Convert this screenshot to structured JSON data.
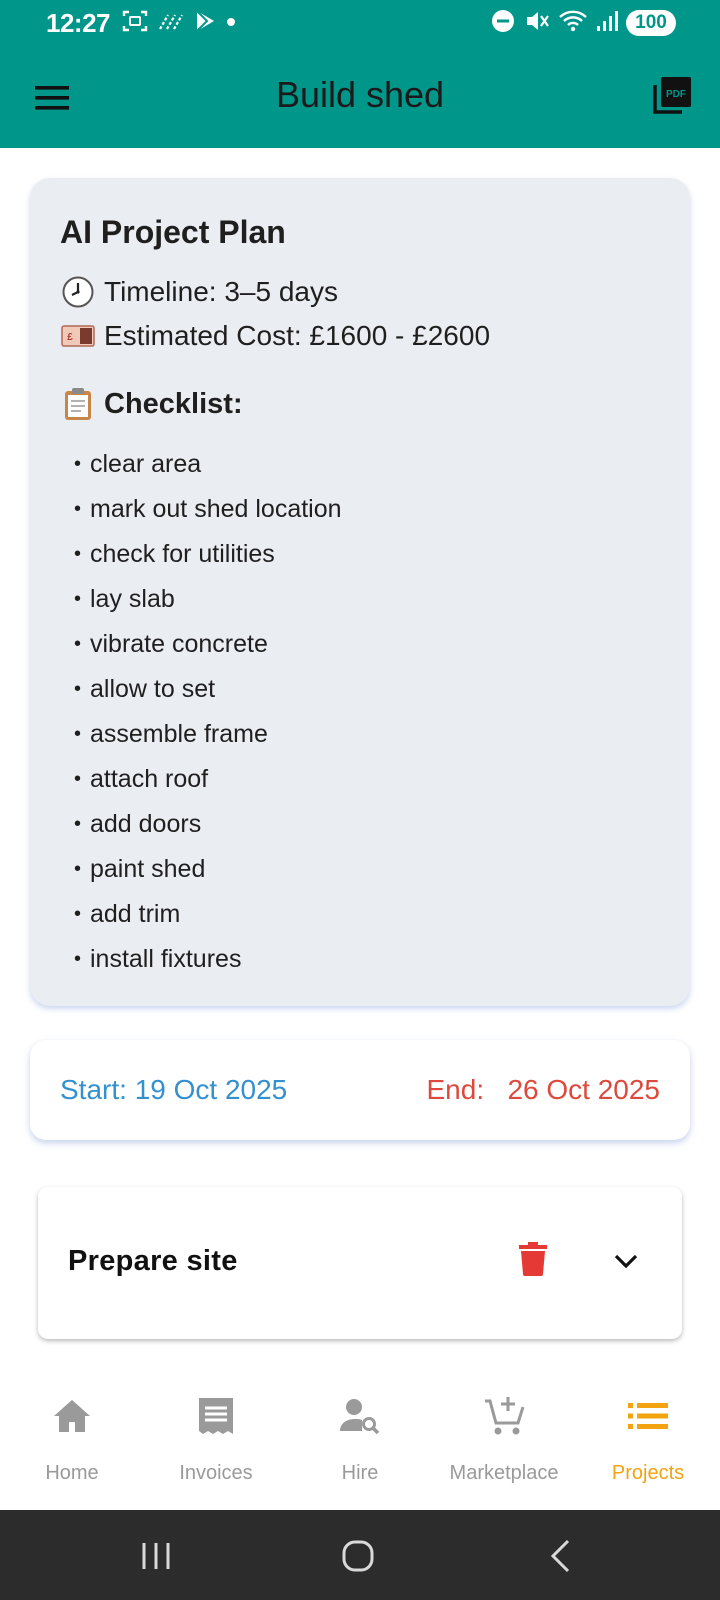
{
  "status_bar": {
    "time": "12:27",
    "battery": "100",
    "icons_left": [
      "screenshot-icon",
      "data-saver-icon",
      "play-store-icon",
      "notification-dot-icon"
    ],
    "icons_right": [
      "dnd-icon",
      "mute-icon",
      "wifi-icon",
      "signal-icon"
    ]
  },
  "app_bar": {
    "title": "Build shed",
    "menu_icon": "menu-icon",
    "pdf_icon": "pdf-icon",
    "background": "#00968a"
  },
  "plan": {
    "title": "AI Project Plan",
    "timeline": "Timeline: 3–5 days",
    "cost": "Estimated Cost: £1600 - £2600",
    "checklist_title": "Checklist:",
    "checklist": [
      "clear area",
      "mark out shed location",
      "check for utilities",
      "lay slab",
      "vibrate concrete",
      "allow to set",
      "assemble frame",
      "attach roof",
      "add doors",
      "paint shed",
      "add trim",
      "install fixtures"
    ]
  },
  "dates": {
    "start": "Start: 19 Oct 2025",
    "end": "End:   26 Oct 2025",
    "start_color": "#3590cf",
    "end_color": "#dd4a3d"
  },
  "task": {
    "title": "Prepare site",
    "delete_icon": "trash-icon",
    "expand_icon": "chevron-down-icon"
  },
  "bottom_nav": {
    "items": [
      {
        "label": "Home",
        "icon": "home-icon"
      },
      {
        "label": "Invoices",
        "icon": "receipt-icon"
      },
      {
        "label": "Hire",
        "icon": "person-search-icon"
      },
      {
        "label": "Marketplace",
        "icon": "cart-add-icon"
      },
      {
        "label": "Projects",
        "icon": "list-icon"
      }
    ],
    "active": "Projects",
    "active_color": "#f2a30f",
    "inactive_color": "#9a9a9a"
  },
  "system_nav": {
    "buttons": [
      "recents-icon",
      "home-circle-icon",
      "back-icon"
    ]
  }
}
